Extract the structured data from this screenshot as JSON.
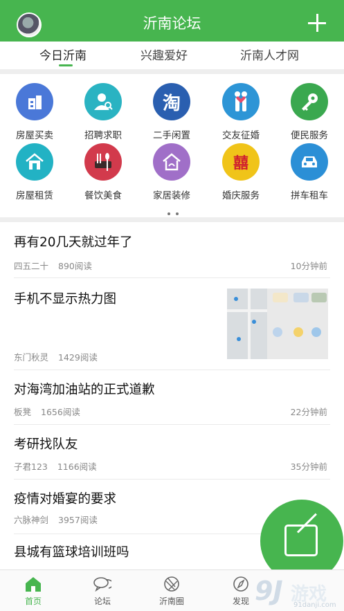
{
  "header": {
    "title": "沂南论坛"
  },
  "tabs": [
    {
      "label": "今日沂南",
      "active": true
    },
    {
      "label": "兴趣爱好",
      "active": false
    },
    {
      "label": "沂南人才网",
      "active": false
    }
  ],
  "categories": [
    {
      "label": "房屋买卖",
      "icon": "building-icon",
      "color": "#4a78d8"
    },
    {
      "label": "招聘求职",
      "icon": "job-seeker-icon",
      "color": "#2ab3c2"
    },
    {
      "label": "二手闲置",
      "icon": "taobao-icon",
      "color": "#2a5fb0"
    },
    {
      "label": "交友征婚",
      "icon": "couple-icon",
      "color": "#2d95d6"
    },
    {
      "label": "便民服务",
      "icon": "key-icon",
      "color": "#3aa84f"
    },
    {
      "label": "房屋租赁",
      "icon": "house-icon",
      "color": "#22b2c4"
    },
    {
      "label": "餐饮美食",
      "icon": "utensils-icon",
      "color": "#d23a4c"
    },
    {
      "label": "家居装修",
      "icon": "home-decor-icon",
      "color": "#a06fc8"
    },
    {
      "label": "婚庆服务",
      "icon": "double-happiness-icon",
      "color": "#f0c419"
    },
    {
      "label": "拼车租车",
      "icon": "car-icon",
      "color": "#2b8fd6"
    }
  ],
  "pager": {
    "pages": 2,
    "current": 1
  },
  "posts": [
    {
      "title": "再有20几天就过年了",
      "author": "四五二十",
      "reads": "890阅读",
      "time": "10分钟前"
    },
    {
      "title": "手机不显示热力图",
      "author": "东门秋灵",
      "reads": "1429阅读",
      "time": ""
    },
    {
      "title": "对海湾加油站的正式道歉",
      "author": "板凳",
      "reads": "1656阅读",
      "time": "22分钟前"
    },
    {
      "title": "考研找队友",
      "author": "子君123",
      "reads": "1166阅读",
      "time": "35分钟前"
    },
    {
      "title": "疫情对婚宴的要求",
      "author": "六脉神剑",
      "reads": "3957阅读",
      "time": ""
    },
    {
      "title": "县城有篮球培训班吗",
      "author": "",
      "reads": "",
      "time": ""
    }
  ],
  "bottom_nav": [
    {
      "label": "首页",
      "icon": "home-icon",
      "active": true
    },
    {
      "label": "论坛",
      "icon": "chat-bubbles-icon",
      "active": false
    },
    {
      "label": "沂南圈",
      "icon": "aperture-icon",
      "active": false
    },
    {
      "label": "发现",
      "icon": "compass-icon",
      "active": false
    }
  ],
  "watermark": {
    "number": "9J",
    "text": "游戏",
    "site": "91danji.com"
  },
  "colors": {
    "brand": "#47b54f",
    "meta_text": "#888888"
  }
}
